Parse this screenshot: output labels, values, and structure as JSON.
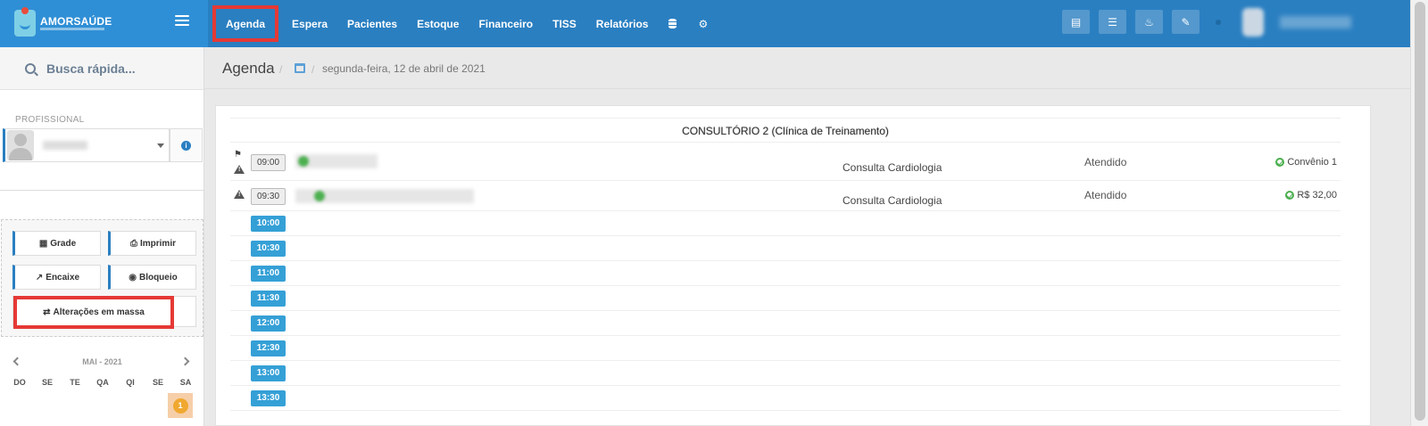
{
  "brand": {
    "name": "AMORSAÚDE"
  },
  "nav": {
    "items": [
      "Agenda",
      "Espera",
      "Pacientes",
      "Estoque",
      "Financeiro",
      "TISS",
      "Relatórios"
    ],
    "active": "Agenda"
  },
  "topbar_icons": [
    "inbox-icon",
    "list-icon",
    "bell-icon",
    "chat-icon"
  ],
  "sidebar": {
    "search_label": "Busca rápida...",
    "professional_label": "PROFISSIONAL",
    "buttons": {
      "grade": "Grade",
      "imprimir": "Imprimir",
      "encaixe": "Encaixe",
      "bloqueio": "Bloqueio",
      "mass": "Alterações em massa"
    },
    "calendar": {
      "title": "MAI - 2021",
      "weekdays": [
        "DO",
        "SE",
        "TE",
        "QA",
        "QI",
        "SE",
        "SA"
      ],
      "first_day": "1"
    }
  },
  "page": {
    "title": "Agenda",
    "date": "segunda-feira, 12 de abril de 2021"
  },
  "agenda": {
    "room": "CONSULTÓRIO 2 (Clínica de Treinamento)",
    "appointments": [
      {
        "time": "09:00",
        "procedure": "Consulta Cardiologia",
        "status": "Atendido",
        "payment": "Convênio 1"
      },
      {
        "time": "09:30",
        "procedure": "Consulta Cardiologia",
        "status": "Atendido",
        "payment": "R$ 32,00"
      }
    ],
    "free_slots": [
      "10:00",
      "10:30",
      "11:00",
      "11:30",
      "12:00",
      "12:30",
      "13:00",
      "13:30"
    ]
  },
  "colors": {
    "topbar": "#2a7fc1",
    "brand": "#2f8fd6",
    "slot": "#35a0d6",
    "highlight": "#e53935"
  }
}
